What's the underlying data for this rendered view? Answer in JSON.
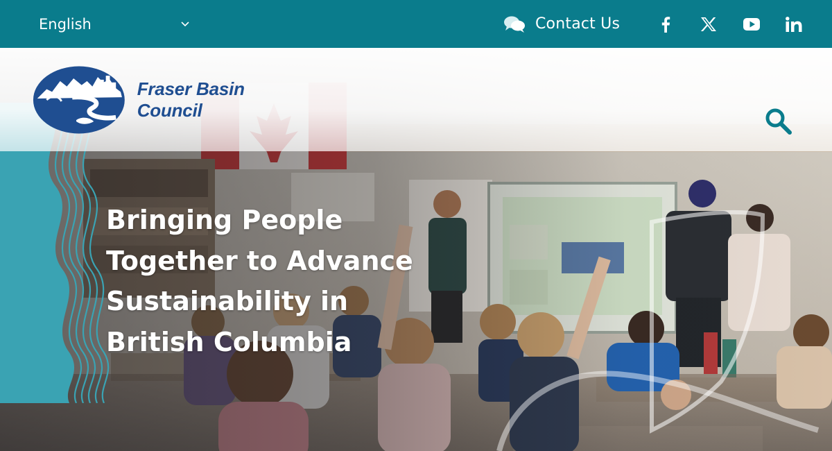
{
  "topbar": {
    "language": {
      "selected": "English",
      "icon": "chevron-down-icon"
    },
    "contact": {
      "label": "Contact Us",
      "icon": "chat-bubbles-icon"
    },
    "social": [
      {
        "name": "facebook",
        "icon": "facebook-icon"
      },
      {
        "name": "x",
        "icon": "x-icon"
      },
      {
        "name": "youtube",
        "icon": "youtube-icon"
      },
      {
        "name": "linkedin",
        "icon": "linkedin-icon"
      }
    ],
    "background_color": "#0a7c8c"
  },
  "header": {
    "logo_text": "Fraser Basin Council",
    "logo_color": "#1f4e91",
    "search_icon": "search-icon",
    "search_color": "#0a7c8c"
  },
  "hero": {
    "headline": "Bringing People Together to Advance Sustainability in British Columbia",
    "wave_color": "#3aa3b3"
  }
}
